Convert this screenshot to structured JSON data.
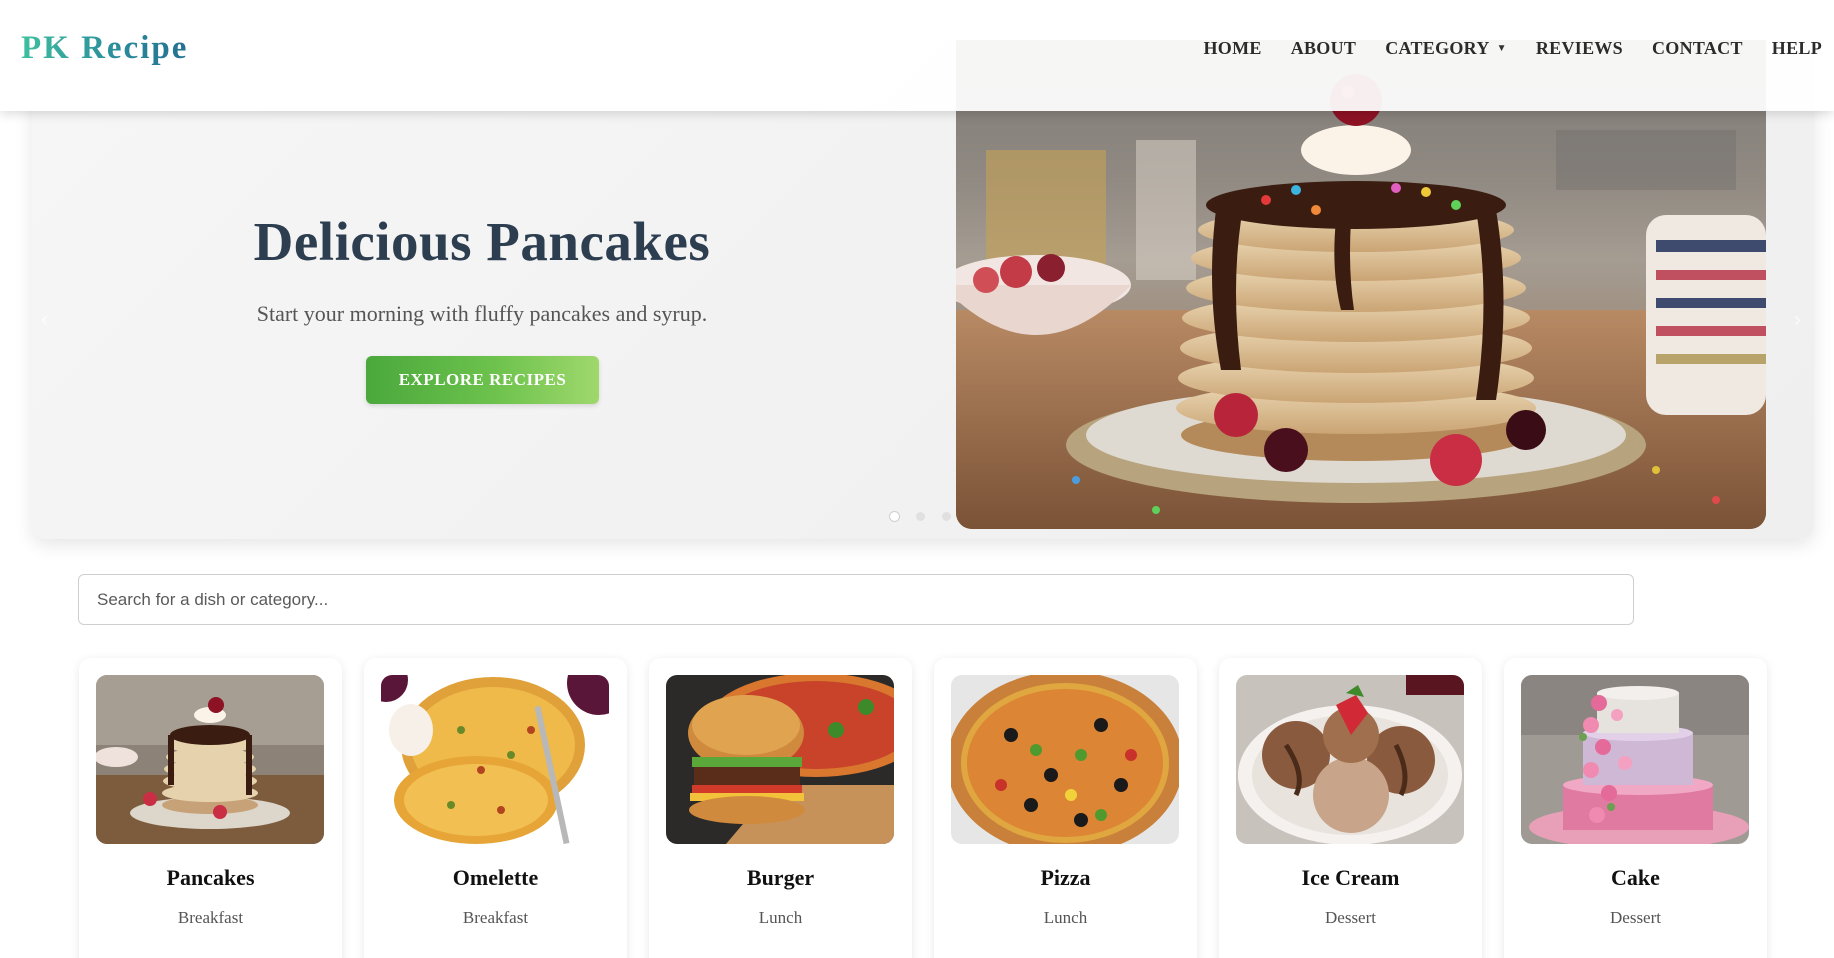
{
  "brand": {
    "logo": "PK Recipe"
  },
  "nav": [
    {
      "label": "HOME",
      "dropdown": false
    },
    {
      "label": "ABOUT",
      "dropdown": false
    },
    {
      "label": "CATEGORY",
      "dropdown": true
    },
    {
      "label": "REVIEWS",
      "dropdown": false
    },
    {
      "label": "CONTACT",
      "dropdown": false
    },
    {
      "label": "HELP",
      "dropdown": false
    }
  ],
  "hero": {
    "title": "Delicious Pancakes",
    "subtitle": "Start your morning with fluffy pancakes and syrup.",
    "button": "EXPLORE RECIPES",
    "slide_count": 3,
    "active_slide": 1,
    "image": "pancake-stack-photo"
  },
  "search": {
    "placeholder": "Search for a dish or category..."
  },
  "cards": [
    {
      "title": "Pancakes",
      "category": "Breakfast",
      "image": "pancakes-photo"
    },
    {
      "title": "Omelette",
      "category": "Breakfast",
      "image": "omelette-photo"
    },
    {
      "title": "Burger",
      "category": "Lunch",
      "image": "burger-photo"
    },
    {
      "title": "Pizza",
      "category": "Lunch",
      "image": "pizza-photo"
    },
    {
      "title": "Ice Cream",
      "category": "Dessert",
      "image": "ice-cream-photo"
    },
    {
      "title": "Cake",
      "category": "Dessert",
      "image": "cake-photo"
    }
  ],
  "colors": {
    "title": "#2c3e50",
    "button_start": "#4aa83c",
    "button_end": "#9fd86c",
    "logo_start": "#3fbf9f",
    "logo_end": "#247090"
  }
}
